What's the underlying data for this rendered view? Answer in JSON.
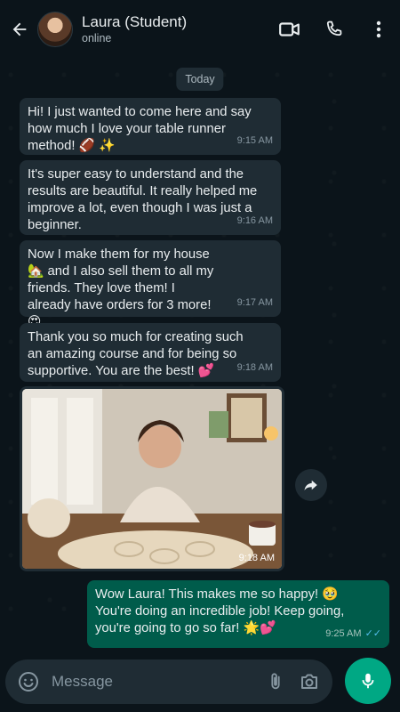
{
  "header": {
    "title": "Laura (Student)",
    "status": "online",
    "icons": [
      "back-arrow-icon",
      "video-call-icon",
      "phone-icon",
      "more-options-icon"
    ]
  },
  "chat": {
    "date_label": "Today",
    "messages": [
      {
        "text": "Hi! I just wanted to come here and say how much I love your table runner method! 🏈 ✨",
        "time": "9:15 AM"
      },
      {
        "text": "It's super easy to understand and the results are beautiful. It really helped me improve a lot, even though I was just a beginner.",
        "time": "9:16 AM"
      },
      {
        "text": "Now I make them for my house 🏡 and I also sell them to all my friends. They love them! I already have orders for 3 more! 😍",
        "time": "9:17 AM"
      },
      {
        "text": "Thank you so much for creating such an amazing course and for being so supportive. You are the best! 💕",
        "time": "9:18 AM"
      },
      {
        "image": "woman-crocheting-lace-table-runner",
        "time": "9:18 AM"
      },
      {
        "text": "Wow Laura! This makes me so happy! 🥹 You're doing an incredible job! Keep going, you're going to go so far! 🌟💕",
        "time": "9:25 AM",
        "outgoing": true
      }
    ]
  },
  "input": {
    "placeholder": "Message",
    "icons": [
      "emoji-icon",
      "attach-icon",
      "camera-icon",
      "mic-icon"
    ]
  },
  "colors": {
    "background": "#0b141a",
    "incoming_bubble": "#1f2c34",
    "outgoing_bubble": "#005c4b",
    "accent": "#00a884",
    "read_ticks": "#53bdeb"
  }
}
